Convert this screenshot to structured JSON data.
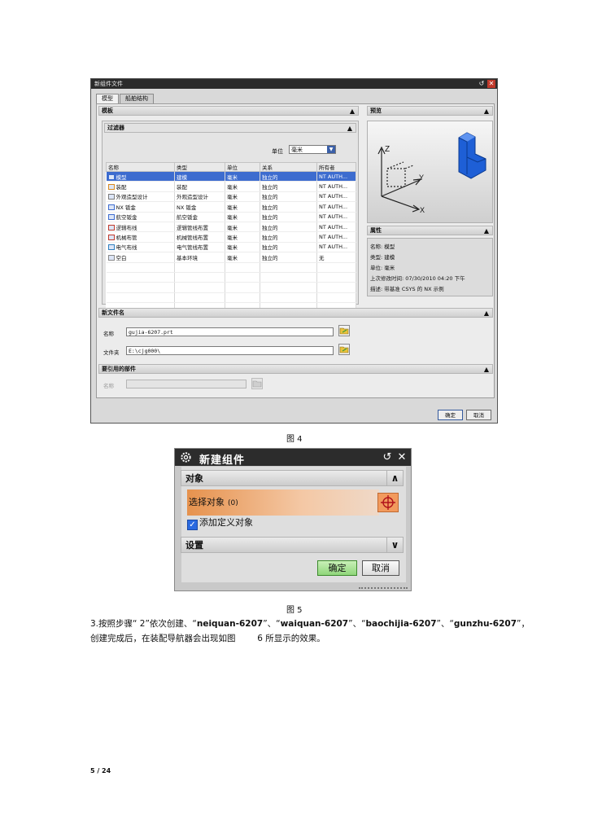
{
  "fig4": {
    "title": "新组件文件",
    "tabs": [
      "模型",
      "船舶结构"
    ],
    "sections": {
      "template": "模板",
      "filter": "过滤器",
      "preview": "预览",
      "props": "属性",
      "new_file_name": "新文件名",
      "referenced_part": "要引用的部件"
    },
    "unit_label": "单位",
    "unit_value": "毫米",
    "columns": [
      "名称",
      "类型",
      "单位",
      "关系",
      "所有者"
    ],
    "rows": [
      [
        "模型",
        "建模",
        "毫米",
        "独立的",
        "NT AUTH..."
      ],
      [
        "装配",
        "装配",
        "毫米",
        "独立的",
        "NT AUTH..."
      ],
      [
        "外观造型设计",
        "外观造型设计",
        "毫米",
        "独立的",
        "NT AUTH..."
      ],
      [
        "NX 钣金",
        "NX 钣金",
        "毫米",
        "独立的",
        "NT AUTH..."
      ],
      [
        "航空钣金",
        "航空钣金",
        "毫米",
        "独立的",
        "NT AUTH..."
      ],
      [
        "逻辑布线",
        "逻辑管线布置",
        "毫米",
        "独立的",
        "NT AUTH..."
      ],
      [
        "机械布管",
        "机械管线布置",
        "毫米",
        "独立的",
        "NT AUTH..."
      ],
      [
        "电气布线",
        "电气管线布置",
        "毫米",
        "独立的",
        "NT AUTH..."
      ],
      [
        "空白",
        "基本环境",
        "毫米",
        "独立的",
        "无"
      ]
    ],
    "properties": [
      "名称: 模型",
      "类型: 建模",
      "单位: 毫米",
      "上次修改时间: 07/30/2010 04:20 下午",
      "描述: 带基准 CSYS 的 NX 示例"
    ],
    "axis_labels": {
      "z": "Z",
      "y": "Y",
      "x": "X"
    },
    "name_label": "名称",
    "name_value": "gujia-6207.prt",
    "folder_label": "文件夹",
    "folder_value": "E:\\cjg000\\",
    "ref_name_label": "名称",
    "ok": "确定",
    "cancel": "取消"
  },
  "caption4": "图 4",
  "fig5": {
    "title": "新建组件",
    "section_object": "对象",
    "select_object": "选择对象",
    "select_count": "(0)",
    "add_defining": "添加定义对象",
    "section_settings": "设置",
    "ok": "确定",
    "cancel": "取消"
  },
  "caption5": "图 5",
  "paragraph": {
    "p1a": "3.按照步骤“ 2”依次创建、“",
    "n1": "neiquan-6207",
    "p1b": "”、“",
    "n2": "waiquan-6207",
    "p1c": "”、“",
    "n3": "baochijia-6207",
    "p1d": "”、“",
    "n4": "gunzhu-6207",
    "p1e": "”，",
    "line2": "创建完成后，在装配导航器会出现如图        6 所显示的效果。"
  },
  "footer": "5 / 24",
  "colors": {
    "selection": "#3d6ccf",
    "select_row": "#e6924e",
    "ok_green": "#8fd67a"
  }
}
